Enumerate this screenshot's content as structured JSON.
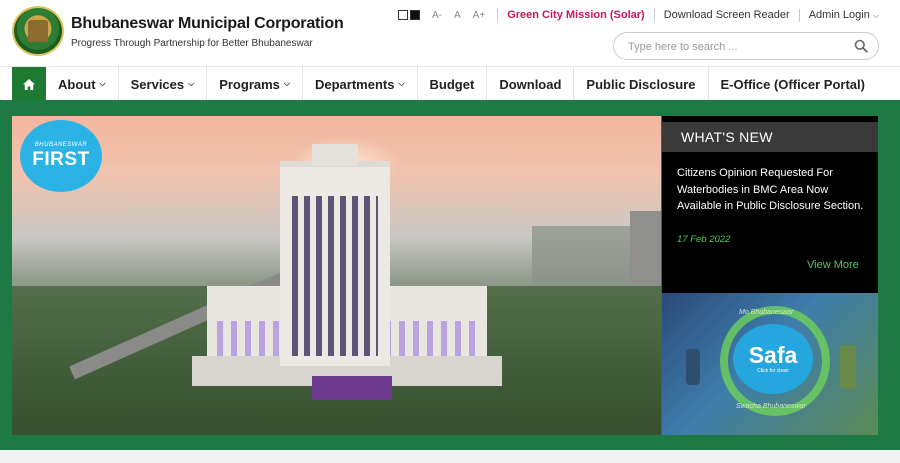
{
  "header": {
    "org_name": "Bhubaneswar Municipal Corporation",
    "tagline": "Progress Through Partnership for Better Bhubaneswar"
  },
  "topbar": {
    "font_small": "A-",
    "font_normal": "A",
    "font_large": "A+",
    "green_city_link": "Green City Mission (Solar)",
    "download_reader": "Download Screen Reader",
    "admin_login": "Admin Login"
  },
  "search": {
    "placeholder": "Type here to search ..."
  },
  "nav": {
    "items": [
      {
        "label": "About"
      },
      {
        "label": "Services"
      },
      {
        "label": "Programs"
      },
      {
        "label": "Departments"
      },
      {
        "label": "Budget"
      },
      {
        "label": "Download"
      },
      {
        "label": "Public Disclosure"
      },
      {
        "label": "E-Office (Officer Portal)"
      }
    ]
  },
  "hero": {
    "badge_small": "BHUBANESWAR",
    "badge_big": "FIRST"
  },
  "whats_new": {
    "heading": "WHAT'S NEW",
    "item_text": "Citizens Opinion Requested For Waterbodies in BMC Area Now Available in Public Disclosure Section.",
    "item_date": "17 Feb 2022",
    "view_more": "View More"
  },
  "safa": {
    "top_text": "Mo Bhubaneswar",
    "word": "Safa",
    "sub": "Click for clean",
    "bottom_text": "Swacha Bhubaneswar"
  },
  "colors": {
    "brand_green": "#1e7a33",
    "band_green": "#1e7a45",
    "link_magenta": "#c2185b",
    "news_green": "#4ccd5d"
  }
}
